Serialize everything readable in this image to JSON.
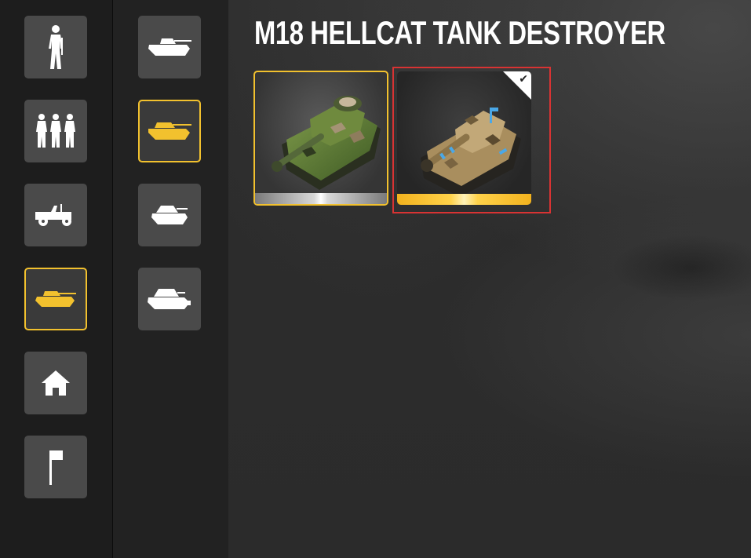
{
  "title": "M18 HELLCAT TANK DESTROYER",
  "colors": {
    "accent": "#f2c12e",
    "selection_outline": "#d83333",
    "button_bg": "#4a4a4a"
  },
  "categories": [
    {
      "icon": "soldier-icon",
      "selected": false
    },
    {
      "icon": "squad-icon",
      "selected": false
    },
    {
      "icon": "jeep-icon",
      "selected": false
    },
    {
      "icon": "tank-icon",
      "selected": true
    },
    {
      "icon": "house-icon",
      "selected": false
    },
    {
      "icon": "flag-icon",
      "selected": false
    }
  ],
  "subcategories": [
    {
      "icon": "light-tank-icon",
      "selected": false
    },
    {
      "icon": "tank-destroyer-icon",
      "selected": true
    },
    {
      "icon": "medium-tank-icon",
      "selected": false
    },
    {
      "icon": "heavy-tank-icon",
      "selected": false
    }
  ],
  "skins": [
    {
      "name": "green-camo-skin",
      "selected": true,
      "equipped": false
    },
    {
      "name": "desert-camo-skin",
      "selected": false,
      "equipped": true
    }
  ]
}
